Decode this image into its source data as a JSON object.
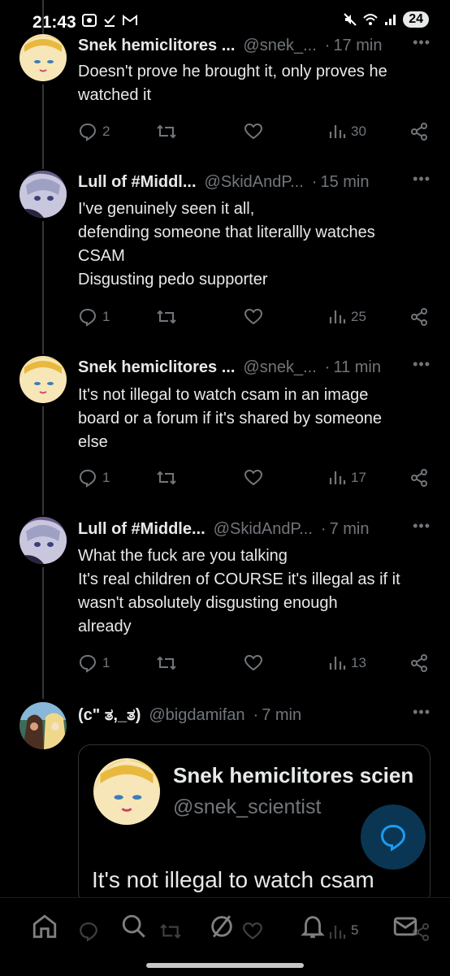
{
  "status_bar": {
    "time": "21:43",
    "battery": "24"
  },
  "tweets": [
    {
      "name": "Snek hemiclitores ...",
      "handle": "@snek_...",
      "time": "17 min",
      "lines": [
        "Doesn't prove  he brought it, only proves he",
        "watched it"
      ],
      "replies": "2",
      "views": "30"
    },
    {
      "name": "Lull of #Middl...",
      "handle": "@SkidAndP...",
      "time": "15 min",
      "lines": [
        "I've genuinely seen it all,",
        "defending someone that literallly watches",
        "CSAM",
        "Disgusting pedo supporter"
      ],
      "replies": "1",
      "views": "25"
    },
    {
      "name": "Snek hemiclitores ...",
      "handle": "@snek_...",
      "time": "11 min",
      "lines": [
        "It's not illegal to watch csam in an image",
        "board or a forum if it's shared by someone",
        "else"
      ],
      "replies": "1",
      "views": "17"
    },
    {
      "name": "Lull of #Middle...",
      "handle": "@SkidAndP...",
      "time": "7 min",
      "lines": [
        "What the fuck are you talking",
        "It's real children of COURSE it's illegal as if it",
        "wasn't absolutely disgusting enough",
        "already"
      ],
      "replies": "1",
      "views": "13"
    },
    {
      "name": "(c\" ತ,_ತ)",
      "handle": "@bigdamifan",
      "time": "7 min"
    }
  ],
  "quote": {
    "name": "Snek hemiclitores scien",
    "handle": "@snek_scientist",
    "text": "It's not illegal to watch csam"
  },
  "bottom_nav": {
    "views": "5"
  },
  "colors": {
    "background": "#000000",
    "text": "#e7e9ea",
    "muted": "#71767b",
    "accent": "#1d9bf0"
  }
}
